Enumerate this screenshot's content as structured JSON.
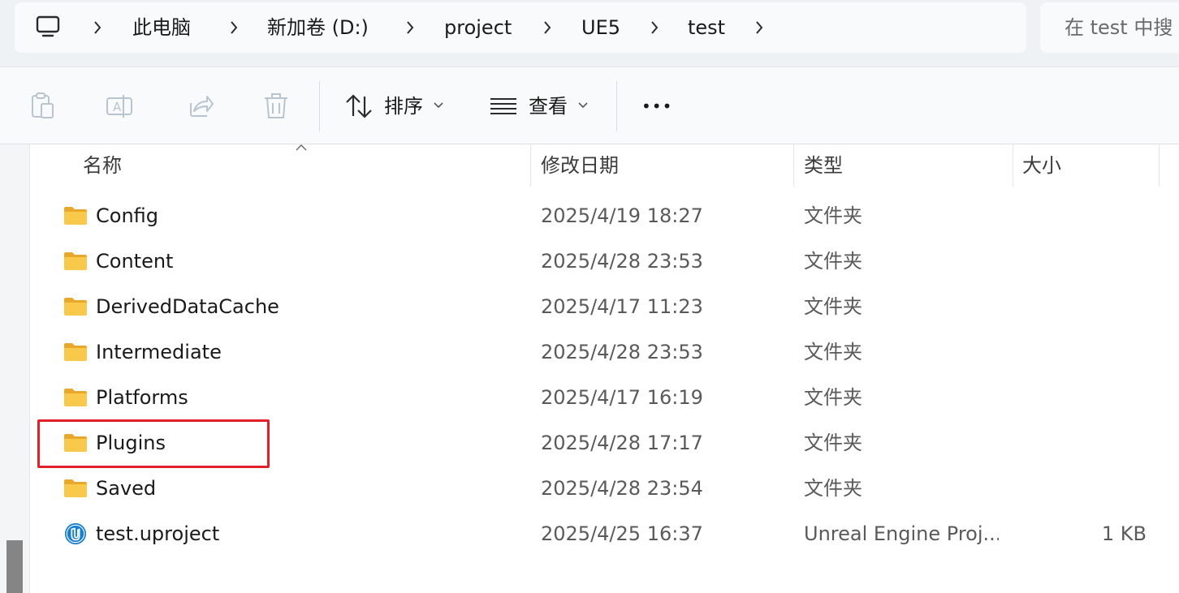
{
  "breadcrumb": {
    "items": [
      "此电脑",
      "新加卷 (D:)",
      "project",
      "UE5",
      "test"
    ]
  },
  "search": {
    "placeholder": "在 test 中搜"
  },
  "toolbar": {
    "sort_label": "排序",
    "view_label": "查看",
    "more_label": "•••"
  },
  "columns": {
    "name": "名称",
    "date": "修改日期",
    "type": "类型",
    "size": "大小"
  },
  "files": [
    {
      "name": "Config",
      "date": "2025/4/19 18:27",
      "type": "文件夹",
      "size": "",
      "icon": "folder-icon"
    },
    {
      "name": "Content",
      "date": "2025/4/28 23:53",
      "type": "文件夹",
      "size": "",
      "icon": "folder-icon"
    },
    {
      "name": "DerivedDataCache",
      "date": "2025/4/17 11:23",
      "type": "文件夹",
      "size": "",
      "icon": "folder-icon"
    },
    {
      "name": "Intermediate",
      "date": "2025/4/28 23:53",
      "type": "文件夹",
      "size": "",
      "icon": "folder-icon"
    },
    {
      "name": "Platforms",
      "date": "2025/4/17 16:19",
      "type": "文件夹",
      "size": "",
      "icon": "folder-icon"
    },
    {
      "name": "Plugins",
      "date": "2025/4/28 17:17",
      "type": "文件夹",
      "size": "",
      "icon": "folder-icon"
    },
    {
      "name": "Saved",
      "date": "2025/4/28 23:54",
      "type": "文件夹",
      "size": "",
      "icon": "folder-icon"
    },
    {
      "name": "test.uproject",
      "date": "2025/4/25 16:37",
      "type": "Unreal Engine Proj...",
      "size": "1 KB",
      "icon": "unreal-engine-icon"
    }
  ],
  "colors": {
    "highlight": "#e0202a",
    "folder": "#f8c94a"
  }
}
